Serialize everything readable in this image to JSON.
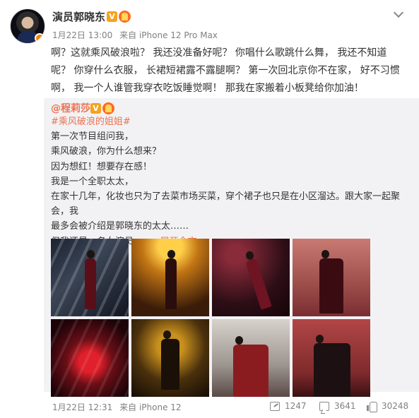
{
  "post": {
    "author": "演员郭晓东",
    "verified_badge": "V",
    "date": "1月22日 13:00",
    "source": "来自 iPhone 12 Pro Max",
    "text_lines": [
      "啊？这就乘风破浪啦？ 我还没准备好呢？ 你唱什么歌跳什么舞， 我还不知道",
      "呢？ 你穿什么衣服， 长裙短裙露不露腿啊？ 第一次回北京你不在家， 好不习惯",
      "啊， 我一个人谁管我穿衣吃饭睡觉啊！ 那我在家搬着小板凳给你加油！"
    ]
  },
  "repost": {
    "author": "@程莉莎",
    "verified_badge": "V",
    "hashtag": "#乘风破浪的姐姐#",
    "lines": [
      "第一次节目组问我，",
      "乘风破浪，你为什么想来？",
      "因为想红！想要存在感！",
      "我是一个全职太太，",
      "在家十几年，化妆也只为了去菜市场买菜，穿个裙子也只是在小区溜达。跟大家一起聚会，我",
      "最多会被介绍是郭晓东的太太……",
      "但我还是一名女演员，..."
    ],
    "expand_label": "展开全文",
    "footer": {
      "date": "1月22日 12:31",
      "source": "来自 iPhone 12",
      "reposts": "1247",
      "comments": "3641",
      "likes": "30248"
    }
  },
  "icons": {
    "caret": "chevron-down-icon",
    "share": "share-icon",
    "comment": "comment-icon",
    "like": "thumbs-up-icon"
  },
  "colors": {
    "accent": "#eb7350",
    "muted": "#808080",
    "repost_bg": "#f2f2f5",
    "verified": "#f7a21b"
  }
}
